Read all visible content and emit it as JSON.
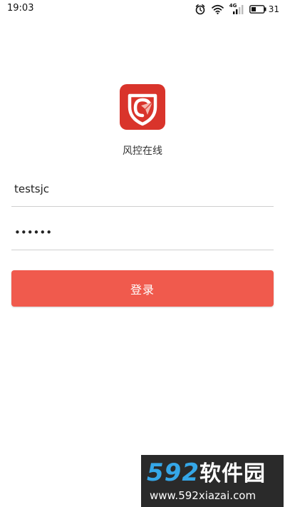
{
  "status_bar": {
    "time": "19:03",
    "network_label": "4G",
    "battery_level": "31",
    "icons": [
      "alarm-icon",
      "wifi-icon",
      "signal-icon",
      "battery-icon"
    ]
  },
  "app": {
    "name": "风控在线",
    "logo_icon": "shield-paper-plane-logo",
    "logo_color": "#d9342b"
  },
  "form": {
    "username_value": "testsjc",
    "password_value": "123456",
    "login_label": "登录",
    "accent_color": "#f05a4d"
  },
  "watermark": {
    "brand_number": "592",
    "brand_text": "软件园",
    "url": "www.592xiazai.com"
  }
}
